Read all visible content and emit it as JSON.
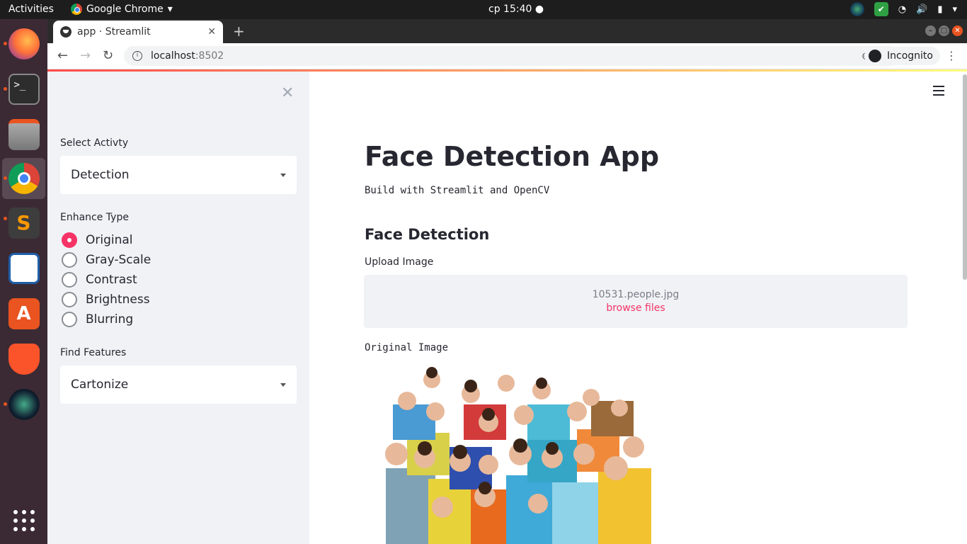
{
  "os": {
    "activities_label": "Activities",
    "app_menu_label": "Google Chrome",
    "clock": "cp 15:40"
  },
  "browser": {
    "tab_title": "app · Streamlit",
    "url_host": "localhost",
    "url_port": ":8502",
    "incognito_label": "Incognito"
  },
  "sidebar": {
    "activity_label": "Select Activty",
    "activity_value": "Detection",
    "enhance_label": "Enhance Type",
    "enhance_options": [
      "Original",
      "Gray-Scale",
      "Contrast",
      "Brightness",
      "Blurring"
    ],
    "enhance_selected": "Original",
    "features_label": "Find Features",
    "features_value": "Cartonize"
  },
  "main": {
    "title": "Face Detection App",
    "subtitle": "Build with Streamlit and OpenCV",
    "section_title": "Face Detection",
    "upload_label": "Upload Image",
    "uploaded_file": "10531.people.jpg",
    "browse_label": "browse files",
    "original_label": "Original Image"
  },
  "colors": {
    "accent": "#f63366",
    "sidebar_bg": "#f0f2f6",
    "text": "#262730"
  }
}
